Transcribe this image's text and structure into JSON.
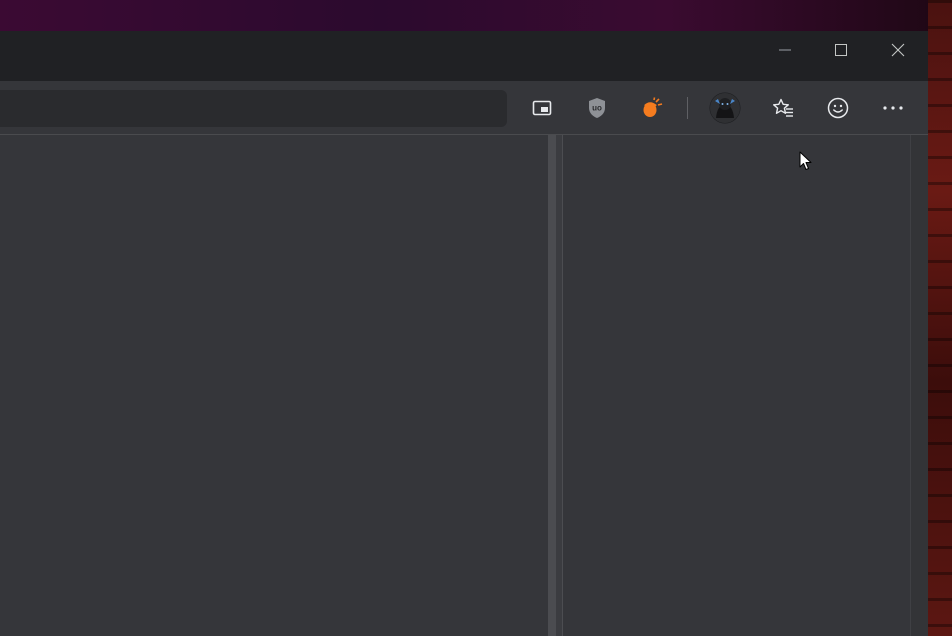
{
  "window": {
    "controls": {
      "minimize_icon": "minimize-icon",
      "maximize_icon": "maximize-icon",
      "close_icon": "close-icon"
    }
  },
  "toolbar": {
    "address_value": "",
    "buttons": [
      {
        "name": "picture-in-picture-button",
        "icon": "picture-in-picture-icon"
      },
      {
        "name": "ublock-origin-extension-button",
        "icon": "ublock-shield-icon",
        "text": "uo"
      },
      {
        "name": "orange-extension-button",
        "icon": "acorn-icon",
        "color": "#f57c1f"
      },
      {
        "name": "profile-button",
        "icon": "avatar"
      },
      {
        "name": "favorites-button",
        "icon": "star-list-icon"
      },
      {
        "name": "feedback-button",
        "icon": "smiley-icon"
      },
      {
        "name": "more-menu-button",
        "icon": "more-dots-icon"
      }
    ]
  },
  "colors": {
    "titlebar": "#202124",
    "toolbar": "#35363a",
    "content": "#35363a",
    "accent_extension": "#f57c1f"
  }
}
